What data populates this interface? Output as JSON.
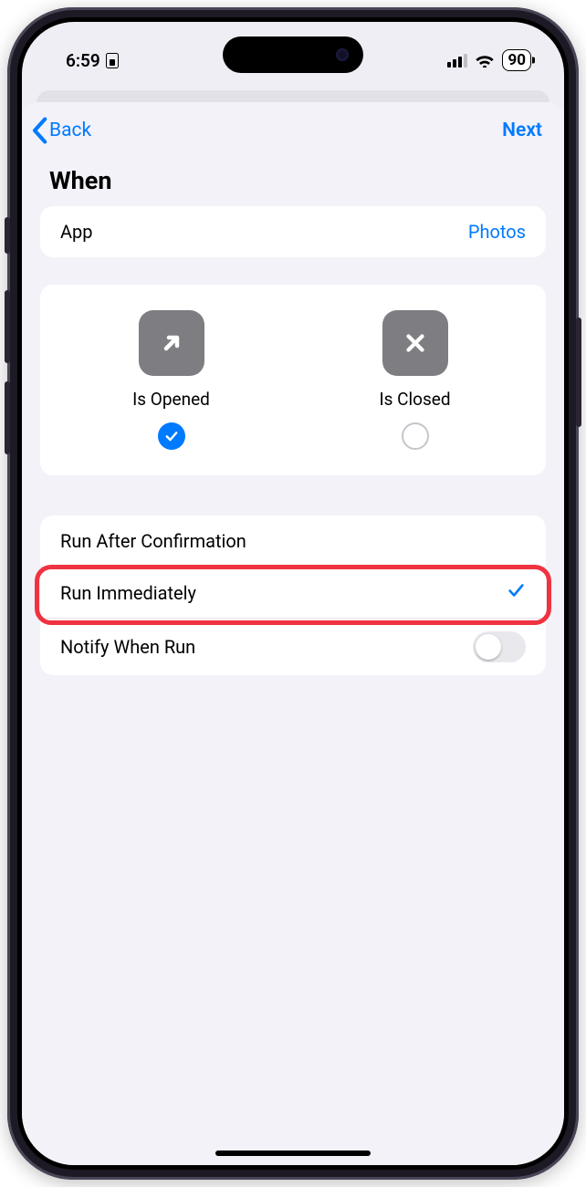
{
  "status": {
    "time": "6:59",
    "battery": "90"
  },
  "nav": {
    "back": "Back",
    "next": "Next"
  },
  "section_title": "When",
  "app_row": {
    "label": "App",
    "value": "Photos"
  },
  "tiles": {
    "opened": {
      "label": "Is Opened"
    },
    "closed": {
      "label": "Is Closed"
    }
  },
  "options": {
    "run_after": "Run After Confirmation",
    "run_immediately": "Run Immediately",
    "notify": "Notify When Run"
  }
}
